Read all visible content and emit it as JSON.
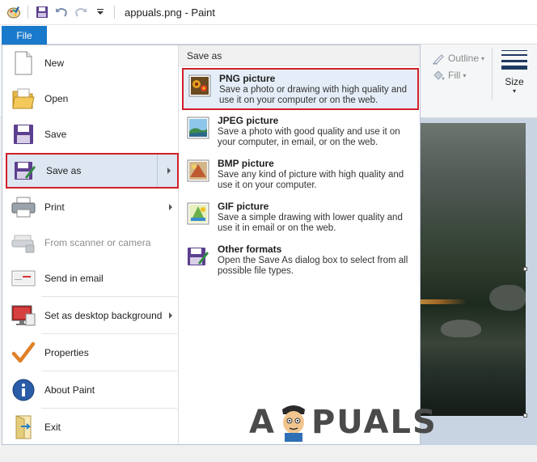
{
  "window": {
    "title": "appuals.png - Paint"
  },
  "quick_access": {
    "icons": [
      "paint-app-icon",
      "save-icon",
      "undo-icon",
      "redo-icon",
      "customize-dropdown-icon"
    ]
  },
  "ribbon": {
    "file_tab": "File",
    "outline_label": "Outline",
    "fill_label": "Fill",
    "size_label": "Size"
  },
  "file_menu": {
    "items": [
      {
        "label": "New",
        "icon": "new-document-icon"
      },
      {
        "label": "Open",
        "icon": "open-folder-icon"
      },
      {
        "label": "Save",
        "icon": "save-icon"
      },
      {
        "label": "Save as",
        "icon": "save-as-icon"
      },
      {
        "label": "Print",
        "icon": "printer-icon"
      },
      {
        "label": "From scanner or camera",
        "icon": "scanner-icon"
      },
      {
        "label": "Send in email",
        "icon": "email-icon"
      },
      {
        "label": "Set as desktop background",
        "icon": "desktop-background-icon"
      },
      {
        "label": "Properties",
        "icon": "checkmark-icon"
      },
      {
        "label": "About Paint",
        "icon": "info-icon"
      },
      {
        "label": "Exit",
        "icon": "exit-icon"
      }
    ]
  },
  "save_as": {
    "header": "Save as",
    "options": [
      {
        "title": "PNG picture",
        "desc": "Save a photo or drawing with high quality and use it on your computer or on the web.",
        "icon": "png-picture-icon"
      },
      {
        "title": "JPEG picture",
        "desc": "Save a photo with good quality and use it on your computer, in email, or on the web.",
        "icon": "jpeg-picture-icon"
      },
      {
        "title": "BMP picture",
        "desc": "Save any kind of picture with high quality and use it on your computer.",
        "icon": "bmp-picture-icon"
      },
      {
        "title": "GIF picture",
        "desc": "Save a simple drawing with lower quality and use it in email or on the web.",
        "icon": "gif-picture-icon"
      },
      {
        "title": "Other formats",
        "desc": "Open the Save As dialog box to select from all possible file types.",
        "icon": "other-formats-icon"
      }
    ]
  },
  "watermark": {
    "text_before": "A",
    "text_after": "PUALS"
  },
  "colors": {
    "file_tab": "#1979ca",
    "highlight_border": "#d0202a",
    "selected_bg": "#dde6f1"
  }
}
